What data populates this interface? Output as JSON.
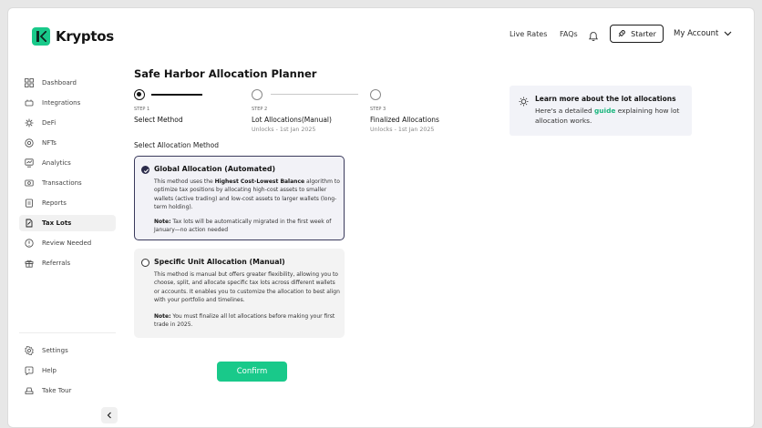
{
  "brand": {
    "name": "Kryptos",
    "accent": "#19c98a"
  },
  "header": {
    "live_rates": "Live Rates",
    "faqs": "FAQs",
    "bell_icon": "bell-icon",
    "starter_label": "Starter",
    "account_label": "My Account"
  },
  "sidebar": {
    "items": [
      {
        "label": "Dashboard",
        "icon": "grid-icon"
      },
      {
        "label": "Integrations",
        "icon": "plug-icon"
      },
      {
        "label": "DeFi",
        "icon": "defi-icon"
      },
      {
        "label": "NFTs",
        "icon": "nft-icon"
      },
      {
        "label": "Analytics",
        "icon": "analytics-icon"
      },
      {
        "label": "Transactions",
        "icon": "transactions-icon"
      },
      {
        "label": "Reports",
        "icon": "reports-icon"
      },
      {
        "label": "Tax Lots",
        "icon": "tax-lots-icon",
        "active": true
      },
      {
        "label": "Review Needed",
        "icon": "review-icon"
      },
      {
        "label": "Referrals",
        "icon": "gift-icon"
      }
    ],
    "bottom": [
      {
        "label": "Settings",
        "icon": "gear-icon"
      },
      {
        "label": "Help",
        "icon": "help-icon"
      },
      {
        "label": "Take Tour",
        "icon": "tour-icon"
      }
    ]
  },
  "main": {
    "title": "Safe Harbor Allocation Planner",
    "steps": [
      {
        "num": "STEP 1",
        "title": "Select Method",
        "sub": ""
      },
      {
        "num": "STEP 2",
        "title": "Lot Allocations(Manual)",
        "sub": "Unlocks - 1st Jan 2025"
      },
      {
        "num": "STEP 3",
        "title": "Finalized Allocations",
        "sub": "Unlocks - 1st Jan 2025"
      }
    ],
    "select_label": "Select Allocation Method",
    "options": [
      {
        "title": "Global Allocation (Automated)",
        "body_pre": "This method uses the ",
        "body_bold": "Highest Cost-Lowest Balance",
        "body_post": " algorithm to optimize tax positions by allocating high-cost assets to smaller wallets (active trading) and low-cost assets to larger wallets (long-term holding).",
        "note_label": "Note:",
        "note_text": " Tax lots will be automatically migrated in the first week of January—no action needed",
        "selected": true
      },
      {
        "title": "Specific Unit Allocation (Manual)",
        "body": "This method is manual but offers greater flexibility, allowing you to choose, split, and allocate specific tax lots across different wallets or accounts. It enables you to customize the allocation to best align with your portfolio and timelines.",
        "note_label": "Note:",
        "note_text": " You must finalize all lot allocations before making your first trade in 2025.",
        "selected": false
      }
    ],
    "confirm_label": "Confirm"
  },
  "info": {
    "title": "Learn more about the lot allocations",
    "body_pre": "Here's a detailed ",
    "link": "guide",
    "body_post": " explaining how lot allocation works."
  }
}
